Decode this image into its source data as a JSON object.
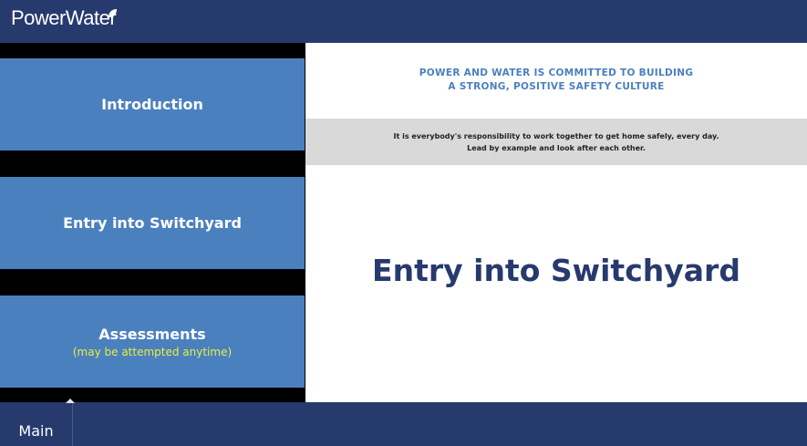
{
  "header": {
    "logo_text": "PowerWater",
    "logo_icon": "leaf-icon"
  },
  "sidebar": {
    "items": [
      {
        "label": "Introduction"
      },
      {
        "label": "Entry into Switchyard"
      },
      {
        "label": "Assessments",
        "sub": "(may be attempted anytime)"
      }
    ]
  },
  "content": {
    "commitment_line1": "POWER AND WATER IS COMMITTED TO BUILDING",
    "commitment_line2": "A STRONG, POSITIVE SAFETY CULTURE",
    "safety_line1": "It is everybody's responsibility to work together to get home safely, every day.",
    "safety_line2": "Lead by example and look after each other.",
    "title": "Entry into Switchyard"
  },
  "footer": {
    "tab_label": "Main"
  },
  "colors": {
    "header": "#273a6e",
    "nav_button": "#4b80bf",
    "subtext": "#e8ef3b",
    "title": "#273a6e"
  }
}
